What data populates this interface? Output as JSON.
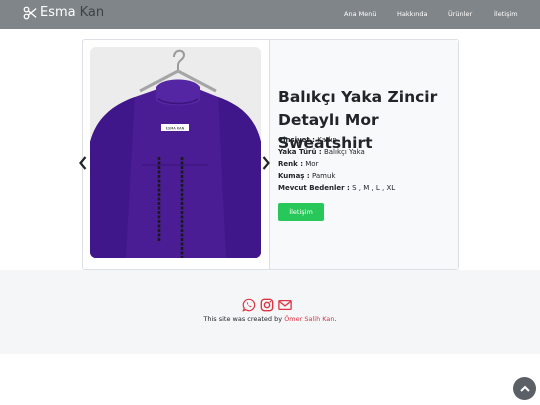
{
  "nav": {
    "brand_part1": "Esma",
    "brand_part2": "Kan",
    "links": [
      "Ana Menü",
      "Hakkında",
      "Ürünler",
      "İletişim"
    ]
  },
  "product": {
    "title": "Balıkçı Yaka Zincir Detaylı Mor Sweatshirt",
    "specs": [
      {
        "label": "Cinsiyet :",
        "value": "Kadın"
      },
      {
        "label": "Yaka Türü :",
        "value": "Balıkçı Yaka"
      },
      {
        "label": "Renk :",
        "value": "Mor"
      },
      {
        "label": "Kumaş :",
        "value": "Pamuk"
      },
      {
        "label": "Mevcut Bedenler :",
        "value": "S , M , L , XL"
      }
    ],
    "contact_button": "İletişim",
    "image_label": "ESMA KAN"
  },
  "footer": {
    "credit_prefix": "This site was created by",
    "credit_author": "Ömer Salih Kan",
    "credit_suffix": "."
  },
  "colors": {
    "navbar": "#808589",
    "button": "#28c75a",
    "footer_icons": "#dc3545",
    "product_purple": "#4a1d94"
  },
  "icons": [
    "scissors-icon",
    "chevron-left-icon",
    "chevron-right-icon",
    "whatsapp-icon",
    "instagram-icon",
    "envelope-icon",
    "chevron-up-icon"
  ]
}
